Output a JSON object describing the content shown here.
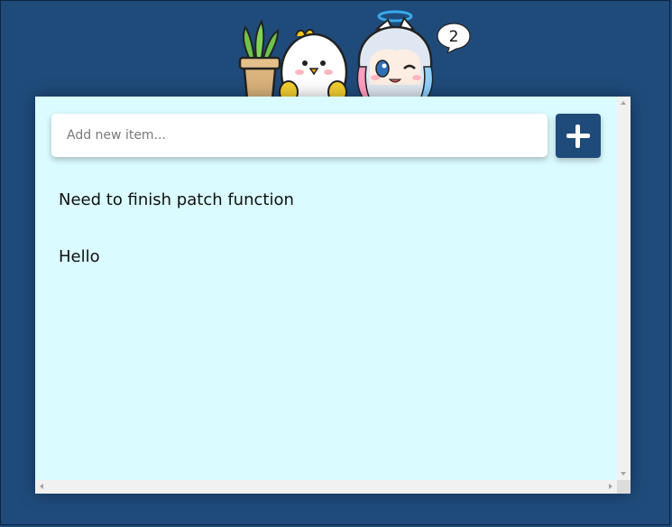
{
  "notification_count": "2",
  "input": {
    "placeholder": "Add new item..."
  },
  "add_button": {
    "icon": "plus-icon"
  },
  "items": [
    {
      "text": "Need to finish patch function"
    },
    {
      "text": "Hello"
    }
  ],
  "colors": {
    "background": "#1f4b7b",
    "panel": "#dafbff",
    "button": "#1f4b7b"
  }
}
